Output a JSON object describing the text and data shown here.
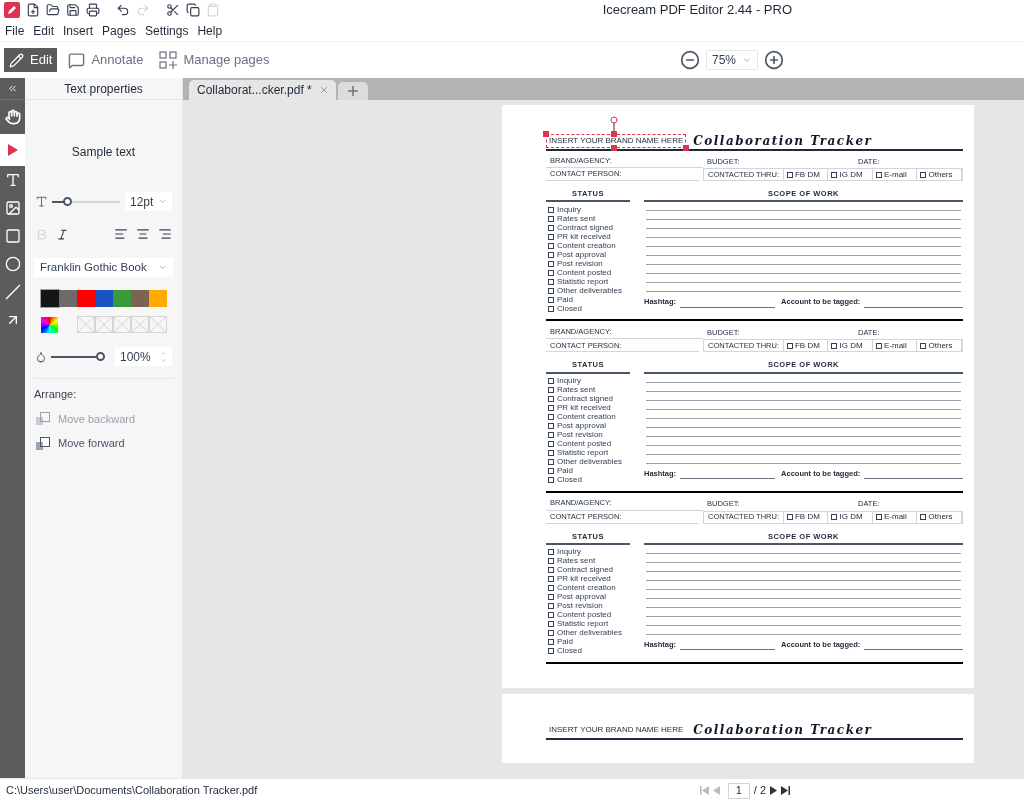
{
  "window": {
    "title": "Icecream PDF Editor 2.44 - PRO"
  },
  "quick_actions": [
    {
      "kind": "new",
      "disabled": false
    },
    {
      "kind": "open",
      "disabled": false
    },
    {
      "kind": "save",
      "disabled": false
    },
    {
      "kind": "print",
      "disabled": false
    },
    {
      "kind": "undo",
      "disabled": false
    },
    {
      "kind": "redo",
      "disabled": true
    },
    {
      "kind": "cut",
      "disabled": false
    },
    {
      "kind": "copy",
      "disabled": false
    },
    {
      "kind": "paste",
      "disabled": true
    }
  ],
  "menu": [
    "File",
    "Edit",
    "Insert",
    "Pages",
    "Settings",
    "Help"
  ],
  "modes": [
    {
      "kind": "edit",
      "label": "Edit",
      "selected": true
    },
    {
      "kind": "annotate",
      "label": "Annotate",
      "selected": false
    },
    {
      "kind": "pages",
      "label": "Manage pages",
      "selected": false
    }
  ],
  "zoom": {
    "value": "75%"
  },
  "tools": [
    {
      "kind": "hand",
      "selected": false
    },
    {
      "kind": "select",
      "selected": true
    },
    {
      "kind": "text",
      "selected": false
    },
    {
      "kind": "image",
      "selected": false
    },
    {
      "kind": "rectangle",
      "selected": false
    },
    {
      "kind": "ellipse",
      "selected": false
    },
    {
      "kind": "line",
      "selected": false
    },
    {
      "kind": "arrow",
      "selected": false
    }
  ],
  "panel": {
    "title": "Text properties",
    "sample": "Sample text",
    "font_size": {
      "level": 0.18,
      "value": "12pt"
    },
    "bold": {
      "disabled": true
    },
    "italic": {
      "disabled": false
    },
    "font": "Franklin Gothic Book",
    "colors": [
      {
        "color": "#151515",
        "selected": true
      },
      {
        "color": "#6b6b6b",
        "selected": false
      },
      {
        "color": "#ff0000",
        "selected": false
      },
      {
        "color": "#1a52c4",
        "selected": false
      },
      {
        "color": "#379a3b",
        "selected": false
      },
      {
        "color": "#7b6450",
        "selected": false
      },
      {
        "color": "#ffaa00",
        "selected": false
      }
    ],
    "opacity": {
      "level": 1,
      "value": "100%"
    },
    "arrange_label": "Arrange:",
    "arrange": [
      {
        "kind": "backward",
        "label": "Move backward",
        "disabled": true
      },
      {
        "kind": "forward",
        "label": "Move forward",
        "disabled": false
      }
    ]
  },
  "tabs": [
    {
      "label": "Collaborat...cker.pdf *",
      "selected": true
    }
  ],
  "pages": [
    {
      "header": {
        "brand": "INSERT YOUR BRAND NAME HERE",
        "brand_selected": true,
        "title": "Collaboration Tracker"
      },
      "sections": [
        {
          "brand_label": "BRAND/AGENCY:",
          "budget_label": "BUDGET:",
          "date_label": "DATE:",
          "contact_label": "CONTACT PERSON:",
          "contacted_label": "CONTACTED THRU:",
          "contact_options": [
            {
              "label": "FB DM",
              "checked": false
            },
            {
              "label": "IG DM",
              "checked": false
            },
            {
              "label": "E-mail",
              "checked": false
            },
            {
              "label": "Others",
              "checked": false
            }
          ],
          "status_heading": "STATUS",
          "scope_heading": "SCOPE OF WORK",
          "statuses": [
            {
              "label": "Inquiry",
              "checked": false
            },
            {
              "label": "Rates sent",
              "checked": false
            },
            {
              "label": "Contract signed",
              "checked": false
            },
            {
              "label": "PR kit received",
              "checked": false
            },
            {
              "label": "Content creation",
              "checked": false
            },
            {
              "label": "Post approval",
              "checked": false
            },
            {
              "label": "Post revision",
              "checked": false
            },
            {
              "label": "Content posted",
              "checked": false
            },
            {
              "label": "Statistic report",
              "checked": false
            },
            {
              "label": "Other deliverables",
              "checked": false
            },
            {
              "label": "Paid",
              "checked": false
            },
            {
              "label": "Closed",
              "checked": false
            }
          ],
          "hashtag_label": "Hashtag:",
          "account_label": "Account to be tagged:"
        },
        {
          "brand_label": "BRAND/AGENCY:",
          "budget_label": "BUDGET:",
          "date_label": "DATE:",
          "contact_label": "CONTACT PERSON:",
          "contacted_label": "CONTACTED THRU:",
          "contact_options": [
            {
              "label": "FB DM",
              "checked": false
            },
            {
              "label": "IG DM",
              "checked": false
            },
            {
              "label": "E-mail",
              "checked": false
            },
            {
              "label": "Others",
              "checked": false
            }
          ],
          "status_heading": "STATUS",
          "scope_heading": "SCOPE OF WORK",
          "statuses": [
            {
              "label": "Inquiry",
              "checked": false
            },
            {
              "label": "Rates sent",
              "checked": false
            },
            {
              "label": "Contract signed",
              "checked": false
            },
            {
              "label": "PR kit received",
              "checked": false
            },
            {
              "label": "Content creation",
              "checked": false
            },
            {
              "label": "Post approval",
              "checked": false
            },
            {
              "label": "Post revision",
              "checked": false
            },
            {
              "label": "Content posted",
              "checked": false
            },
            {
              "label": "Statistic report",
              "checked": false
            },
            {
              "label": "Other deliverables",
              "checked": false
            },
            {
              "label": "Paid",
              "checked": false
            },
            {
              "label": "Closed",
              "checked": false
            }
          ],
          "hashtag_label": "Hashtag:",
          "account_label": "Account to be tagged:"
        },
        {
          "brand_label": "BRAND/AGENCY:",
          "budget_label": "BUDGET:",
          "date_label": "DATE:",
          "contact_label": "CONTACT PERSON:",
          "contacted_label": "CONTACTED THRU:",
          "contact_options": [
            {
              "label": "FB DM",
              "checked": false
            },
            {
              "label": "IG DM",
              "checked": false
            },
            {
              "label": "E-mail",
              "checked": false
            },
            {
              "label": "Others",
              "checked": false
            }
          ],
          "status_heading": "STATUS",
          "scope_heading": "SCOPE OF WORK",
          "statuses": [
            {
              "label": "Inquiry",
              "checked": false
            },
            {
              "label": "Rates sent",
              "checked": false
            },
            {
              "label": "Contract signed",
              "checked": false
            },
            {
              "label": "PR kit received",
              "checked": false
            },
            {
              "label": "Content creation",
              "checked": false
            },
            {
              "label": "Post approval",
              "checked": false
            },
            {
              "label": "Post revision",
              "checked": false
            },
            {
              "label": "Content posted",
              "checked": false
            },
            {
              "label": "Statistic report",
              "checked": false
            },
            {
              "label": "Other deliverables",
              "checked": false
            },
            {
              "label": "Paid",
              "checked": false
            },
            {
              "label": "Closed",
              "checked": false
            }
          ],
          "hashtag_label": "Hashtag:",
          "account_label": "Account to be tagged:"
        }
      ]
    },
    {
      "header": {
        "brand": "INSERT YOUR BRAND NAME HERE",
        "brand_selected": false,
        "title": "Collaboration Tracker"
      }
    }
  ],
  "status_bar": {
    "path": "C:\\Users\\user\\Documents\\Collaboration Tracker.pdf",
    "page": "1",
    "total": "/ 2"
  }
}
